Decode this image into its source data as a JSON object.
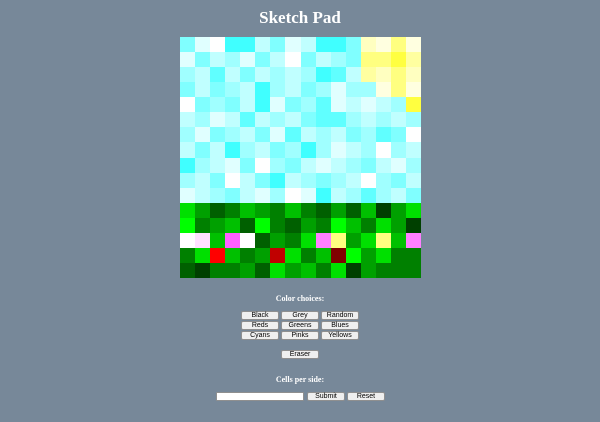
{
  "title": "Sketch Pad",
  "color_choices_label": "Color choices:",
  "color_buttons": [
    "Black",
    "Grey",
    "Random",
    "Reds",
    "Greens",
    "Blues",
    "Cyans",
    "Pinks",
    "Yellows"
  ],
  "eraser_label": "Eraser",
  "cells_label": "Cells per side:",
  "cells_input": {
    "value": "",
    "placeholder": ""
  },
  "submit_label": "Submit",
  "reset_label": "Reset",
  "grid_size": 16,
  "grid_colors": [
    [
      "#80ffff",
      "#e0ffff",
      "#ffffff",
      "#40ffff",
      "#40ffff",
      "#c0ffff",
      "#80ffff",
      "#e0ffff",
      "#c0ffff",
      "#40ffff",
      "#40ffff",
      "#80ffff",
      "#ffffc0",
      "#ffffe0",
      "#ffff80",
      "#ffffe0"
    ],
    [
      "#e0ffff",
      "#80ffff",
      "#c0ffff",
      "#a0ffff",
      "#e0ffff",
      "#80ffff",
      "#c0ffff",
      "#ffffff",
      "#80ffff",
      "#c0ffff",
      "#a0ffff",
      "#80ffff",
      "#ffff80",
      "#ffff80",
      "#ffff40",
      "#ffffa0"
    ],
    [
      "#a0ffff",
      "#c0ffff",
      "#60ffff",
      "#c0ffff",
      "#80ffff",
      "#c0ffff",
      "#a0ffff",
      "#c0ffff",
      "#a0ffff",
      "#40ffff",
      "#60ffff",
      "#c0ffff",
      "#ffffa0",
      "#ffffc0",
      "#ffff80",
      "#ffffc0"
    ],
    [
      "#80ffff",
      "#c0ffff",
      "#80ffff",
      "#a0ffff",
      "#c0ffff",
      "#40ffff",
      "#a0ffff",
      "#c0ffff",
      "#80ffff",
      "#a0ffff",
      "#e0ffff",
      "#a0ffff",
      "#a0ffff",
      "#ffffe0",
      "#ffff80",
      "#ffffe0"
    ],
    [
      "#ffffff",
      "#80ffff",
      "#a0ffff",
      "#80ffff",
      "#c0ffff",
      "#40ffff",
      "#e0ffff",
      "#80ffff",
      "#a0ffff",
      "#60ffff",
      "#e0ffff",
      "#c0ffff",
      "#e0ffff",
      "#c0ffff",
      "#a0ffff",
      "#ffff40"
    ],
    [
      "#c0ffff",
      "#a0ffff",
      "#e0ffff",
      "#c0ffff",
      "#60ffff",
      "#c0ffff",
      "#a0ffff",
      "#c0ffff",
      "#80ffff",
      "#60ffff",
      "#60ffff",
      "#a0ffff",
      "#c0ffff",
      "#a0ffff",
      "#c0ffff",
      "#a0ffff"
    ],
    [
      "#a0ffff",
      "#e0ffff",
      "#80ffff",
      "#a0ffff",
      "#c0ffff",
      "#80ffff",
      "#e0ffff",
      "#60ffff",
      "#c0ffff",
      "#a0ffff",
      "#c0ffff",
      "#80ffff",
      "#a0ffff",
      "#60ffff",
      "#80ffff",
      "#ffffff"
    ],
    [
      "#c0ffff",
      "#80ffff",
      "#c0ffff",
      "#40ffff",
      "#a0ffff",
      "#c0ffff",
      "#80ffff",
      "#a0ffff",
      "#40ffff",
      "#a0ffff",
      "#e0ffff",
      "#c0ffff",
      "#a0ffff",
      "#ffffff",
      "#a0ffff",
      "#c0ffff"
    ],
    [
      "#40ffff",
      "#a0ffff",
      "#c0ffff",
      "#e0ffff",
      "#80ffff",
      "#ffffff",
      "#a0ffff",
      "#80ffff",
      "#c0ffff",
      "#e0ffff",
      "#c0ffff",
      "#a0ffff",
      "#80ffff",
      "#c0ffff",
      "#e0ffff",
      "#a0ffff"
    ],
    [
      "#a0ffff",
      "#c0ffff",
      "#80ffff",
      "#ffffff",
      "#c0ffff",
      "#80ffff",
      "#40ffff",
      "#c0ffff",
      "#a0ffff",
      "#80ffff",
      "#a0ffff",
      "#c0ffff",
      "#ffffff",
      "#a0ffff",
      "#80ffff",
      "#c0ffff"
    ],
    [
      "#e0ffff",
      "#c0ffff",
      "#a0ffff",
      "#80ffff",
      "#c0ffff",
      "#e0ffff",
      "#a0ffff",
      "#ffffff",
      "#e0ffff",
      "#40ffff",
      "#c0ffff",
      "#a0ffff",
      "#60ffff",
      "#a0ffff",
      "#c0ffff",
      "#80ffff"
    ],
    [
      "#00e000",
      "#00a000",
      "#006000",
      "#008000",
      "#00c000",
      "#00a000",
      "#008000",
      "#00c000",
      "#008000",
      "#006000",
      "#00a000",
      "#006000",
      "#00c000",
      "#004000",
      "#00a000",
      "#00e000"
    ],
    [
      "#00ff00",
      "#008000",
      "#00a000",
      "#00c000",
      "#006000",
      "#00ff00",
      "#008000",
      "#006000",
      "#00a000",
      "#008000",
      "#00ff00",
      "#00c000",
      "#008000",
      "#00e000",
      "#00a000",
      "#004000"
    ],
    [
      "#ffffff",
      "#ffe0ff",
      "#00c000",
      "#ff60ff",
      "#ffffff",
      "#006000",
      "#00a000",
      "#008000",
      "#00e000",
      "#ff80ff",
      "#ffff80",
      "#00a000",
      "#00e000",
      "#ffff80",
      "#00c000",
      "#ff80ff"
    ],
    [
      "#008000",
      "#00e000",
      "#ff0000",
      "#00c000",
      "#008000",
      "#00a000",
      "#c00000",
      "#00e000",
      "#008000",
      "#00c000",
      "#800000",
      "#00ff00",
      "#00a000",
      "#00e000",
      "#008000",
      "#008000"
    ],
    [
      "#006000",
      "#004000",
      "#008000",
      "#008000",
      "#00a000",
      "#006000",
      "#00e000",
      "#00a000",
      "#00c000",
      "#008000",
      "#00e000",
      "#004000",
      "#00a000",
      "#008000",
      "#008000",
      "#008000"
    ]
  ]
}
